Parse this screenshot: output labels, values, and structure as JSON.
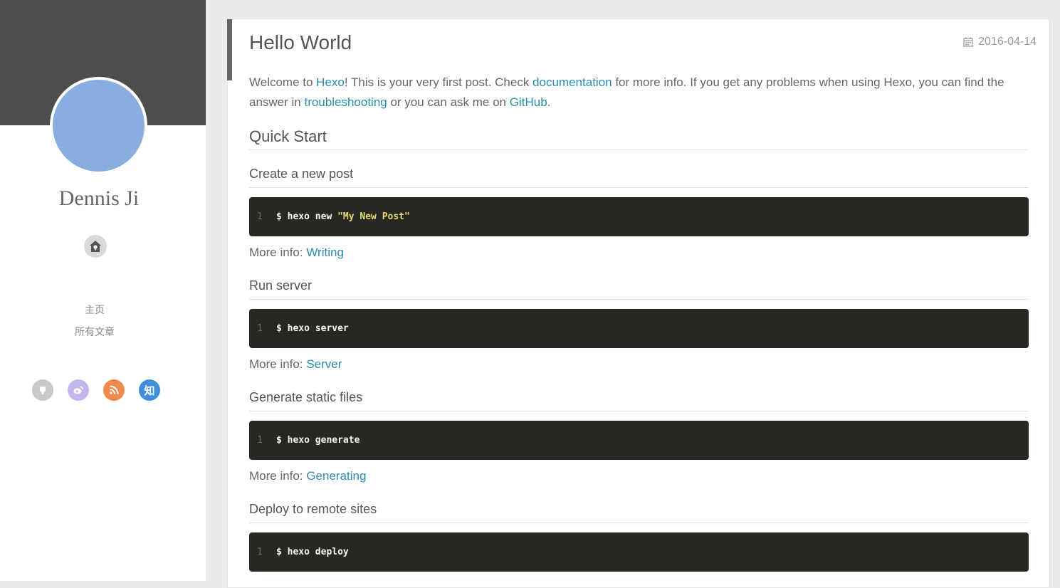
{
  "sidebar": {
    "author": "Dennis Ji",
    "nav": [
      "主页",
      "所有文章"
    ],
    "social_icons": [
      {
        "name": "github-icon",
        "color": "#c8c8c8"
      },
      {
        "name": "weibo-icon",
        "color": "#c6b6f0"
      },
      {
        "name": "rss-icon",
        "color": "#ef8a4c"
      },
      {
        "name": "zhihu-icon",
        "color": "#3e8ed8",
        "glyph": "知"
      }
    ]
  },
  "post": {
    "title": "Hello World",
    "date": "2016-04-14",
    "intro": {
      "t1": "Welcome to ",
      "l1": "Hexo",
      "t2": "! This is your very first post. Check ",
      "l2": "documentation",
      "t3": " for more info. If you get any problems when using Hexo, you can find the answer in ",
      "l3": "troubleshooting",
      "t4": " or you can ask me on ",
      "l4": "GitHub",
      "t5": "."
    },
    "section_heading": "Quick Start",
    "more_info_label": "More info: ",
    "steps": [
      {
        "heading": "Create a new post",
        "line": "1",
        "cmd": "$ hexo new ",
        "arg": "\"My New Post\"",
        "more_link": "Writing"
      },
      {
        "heading": "Run server",
        "line": "1",
        "cmd": "$ hexo server",
        "arg": "",
        "more_link": "Server"
      },
      {
        "heading": "Generate static files",
        "line": "1",
        "cmd": "$ hexo generate",
        "arg": "",
        "more_link": "Generating"
      },
      {
        "heading": "Deploy to remote sites",
        "line": "1",
        "cmd": "$ hexo deploy",
        "arg": "",
        "more_link": ""
      }
    ]
  },
  "colors": {
    "sidebar_banner": "#4d4d4d",
    "avatar": "#8aade0",
    "code_bg": "#272822",
    "link": "#2a8cae"
  }
}
